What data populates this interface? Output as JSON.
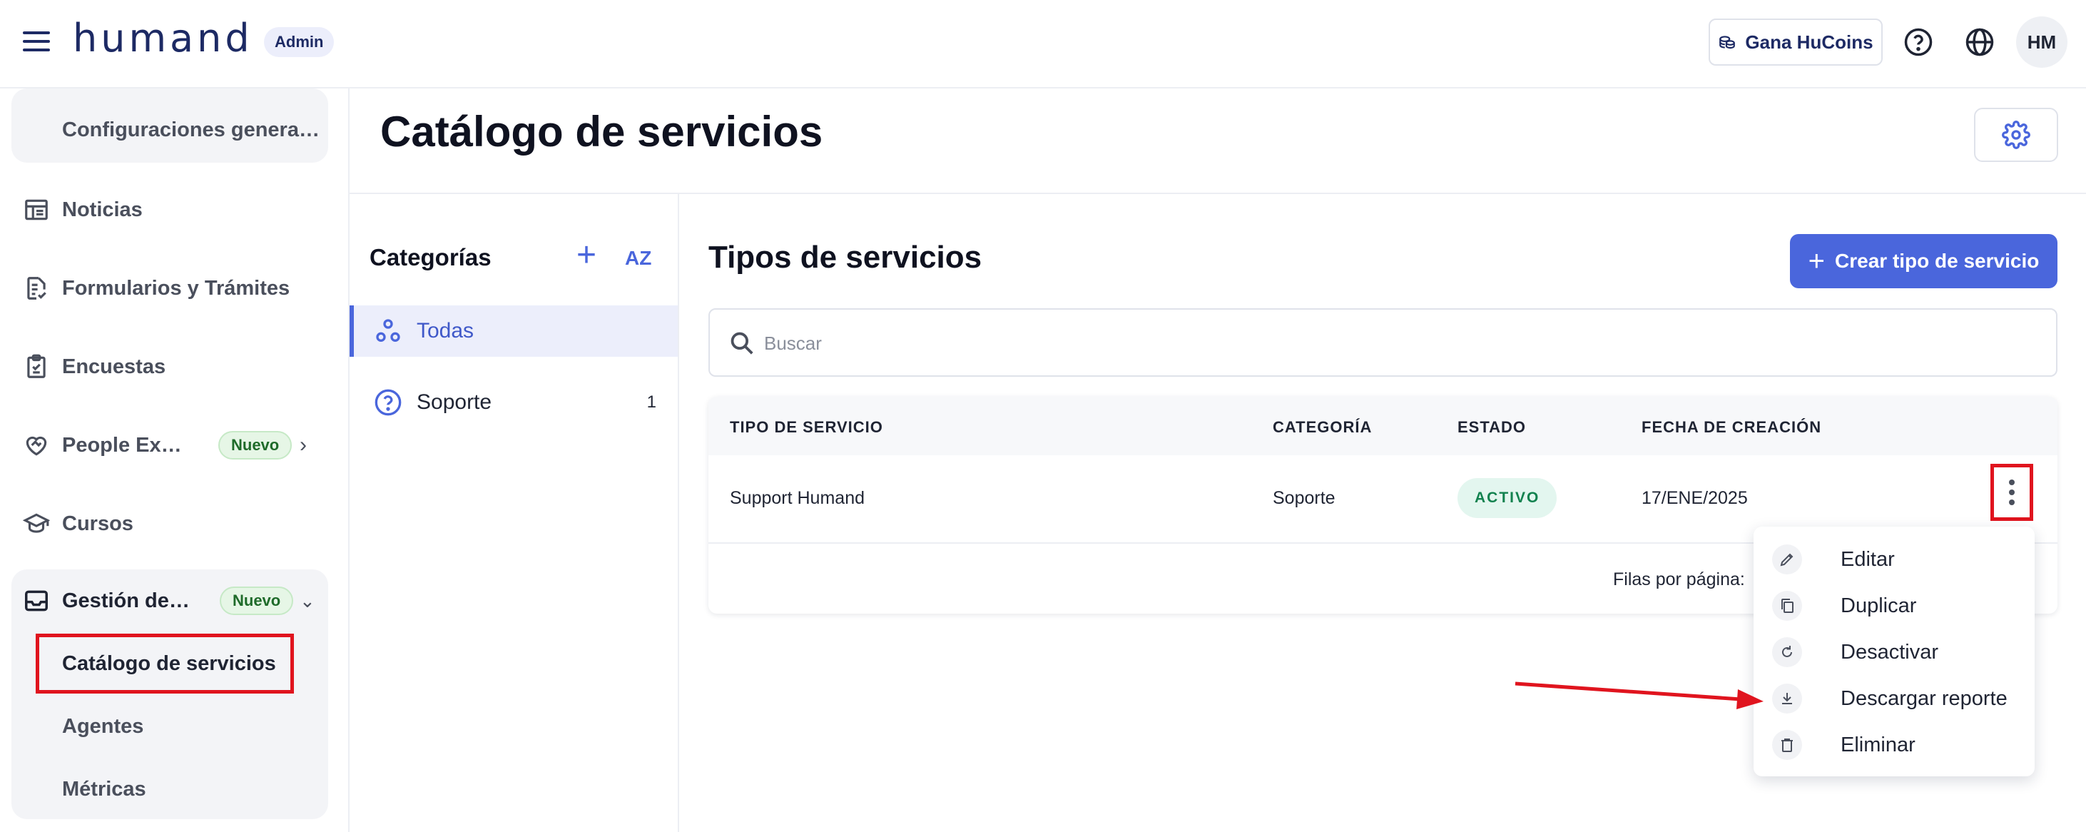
{
  "topbar": {
    "logo": "humand",
    "admin_badge": "Admin",
    "hucoins_label": "Gana HuCoins",
    "avatar_initials": "HM"
  },
  "sidebar": {
    "config_item": "Configuraciones genera…",
    "items": [
      {
        "label": "Noticias",
        "icon": "newspaper-icon"
      },
      {
        "label": "Formularios y Trámites",
        "icon": "form-check-icon"
      },
      {
        "label": "Encuestas",
        "icon": "clipboard-icon"
      },
      {
        "label": "People Ex…",
        "icon": "heart-handshake-icon",
        "badge": "Nuevo"
      },
      {
        "label": "Cursos",
        "icon": "graduation-cap-icon"
      }
    ],
    "service_group": {
      "label": "Gestión de…",
      "badge": "Nuevo",
      "subitems": [
        "Catálogo de servicios",
        "Agentes",
        "Métricas"
      ]
    }
  },
  "page": {
    "title": "Catálogo de servicios"
  },
  "categories": {
    "title": "Categorías",
    "sort_label": "AZ",
    "items": [
      {
        "label": "Todas"
      },
      {
        "label": "Soporte",
        "count": "1"
      }
    ]
  },
  "main": {
    "title": "Tipos de servicios",
    "create_button": "Crear tipo de servicio",
    "search_placeholder": "Buscar",
    "table": {
      "headers": [
        "TIPO DE SERVICIO",
        "CATEGORÍA",
        "ESTADO",
        "FECHA DE CREACIÓN"
      ],
      "rows": [
        {
          "tipo": "Support Humand",
          "categoria": "Soporte",
          "estado": "ACTIVO",
          "fecha": "17/ENE/2025"
        }
      ],
      "rows_per_page_label": "Filas por página:"
    }
  },
  "menu": {
    "items": [
      {
        "label": "Editar",
        "icon": "pencil-icon"
      },
      {
        "label": "Duplicar",
        "icon": "copy-icon"
      },
      {
        "label": "Desactivar",
        "icon": "refresh-icon"
      },
      {
        "label": "Descargar reporte",
        "icon": "download-icon"
      },
      {
        "label": "Eliminar",
        "icon": "trash-icon"
      }
    ]
  },
  "colors": {
    "brand": "#1d2a64",
    "accent": "#4a66dc",
    "highlight": "#e0141e",
    "status_active": "#12824f"
  }
}
